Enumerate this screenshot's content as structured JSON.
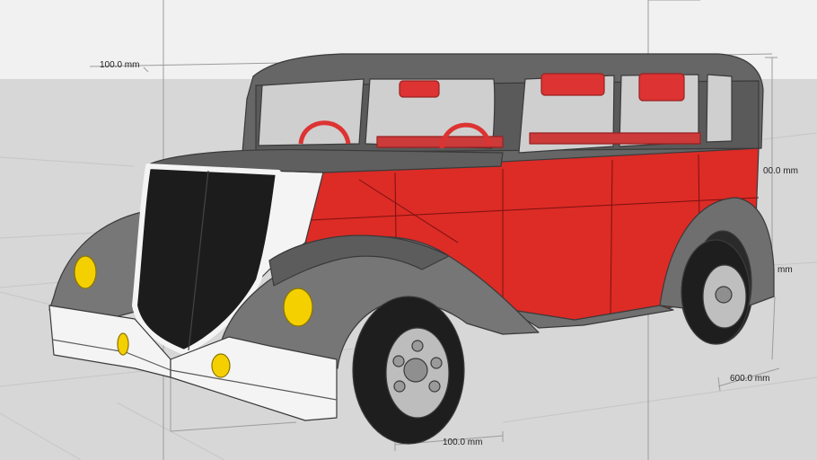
{
  "viewport": {
    "sky_color": "#f1f1f1",
    "ground_color": "#d7d7d7",
    "grid_color": "#c4c4c4",
    "guide_color": "#9a9a9a"
  },
  "model": {
    "body_color": "#dd2b26",
    "fender_color": "#767676",
    "roof_color": "#666666",
    "grille_color": "#1c1c1c",
    "bumper_color": "#f4f4f4",
    "lamp_color": "#f5d000",
    "tire_color": "#1e1e1e",
    "rim_color": "#bdbdbd"
  },
  "dimensions": {
    "top_left": "100.0 mm",
    "right_height": "00.0 mm",
    "right_mid": "mm",
    "right_bottom": "600.0 mm",
    "bottom_center": "100.0 mm"
  }
}
